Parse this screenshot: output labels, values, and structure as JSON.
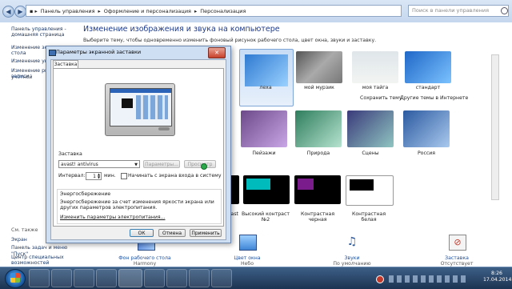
{
  "address": {
    "crumbs": [
      "Панель управления",
      "Оформление и персонализация",
      "Персонализация"
    ],
    "search_placeholder": "Поиск в панели управления"
  },
  "sidebar": {
    "top_links": [
      "Панель управления -",
      "домашняя страница"
    ],
    "links": [
      "Изменение значков",
      "стола",
      "Изменение указателей",
      "Изменение рисунка учетной",
      "записи"
    ],
    "see_also_title": "См. также",
    "see_also": [
      "Экран",
      "Панель задач и меню \"Пуск\"",
      "Центр специальных",
      "возможностей"
    ]
  },
  "main": {
    "title": "Изменение изображения и звука на компьютере",
    "subtitle": "Выберите тему, чтобы одновременно изменить фоновый рисунок рабочего стола, цвет окна, звуки и заставку.",
    "my_themes": [
      "леха",
      "мой мурзик",
      "моя тайга",
      "стандарт"
    ],
    "save_theme": "Сохранить тему",
    "more_themes": "Другие темы в Интернете",
    "aero_themes": [
      "Пейзажи",
      "Природа",
      "Сцены",
      "Россия"
    ],
    "contrast_themes": [
      "ast",
      "Высокий контраст №2",
      "Контрастная черная",
      "Контрастная белая"
    ]
  },
  "bottom": {
    "items": [
      {
        "label": "Фон рабочего стола",
        "sub": "Harmony",
        "icon": "desktop-background-icon"
      },
      {
        "label": "Цвет окна",
        "sub": "Небо",
        "icon": "window-color-icon"
      },
      {
        "label": "Звуки",
        "sub": "По умолчанию",
        "icon": "sounds-icon"
      },
      {
        "label": "Заставка",
        "sub": "Отсутствует",
        "icon": "screensaver-icon"
      }
    ]
  },
  "dialog": {
    "title": "Параметры экранной заставки",
    "tab": "Заставка",
    "screensaver_group": "Заставка",
    "screensaver_value": "avast! antivirus",
    "params_button": "Параметры...",
    "preview_button": "Просмотр",
    "interval_label": "Интервал:",
    "interval_value": "1",
    "minutes": "мин.",
    "resume_checkbox": "Начинать с экрана входа в систему",
    "power_title": "Энергосбережение",
    "power_text": "Энергосбережение за счет изменения яркости экрана или других параметров электропитания.",
    "power_link": "Изменить параметры электропитания...",
    "ok": "ОК",
    "cancel": "Отмена",
    "apply": "Применить"
  },
  "taskbar": {
    "time": "8:26",
    "date": "17.04.2014"
  },
  "colors": {
    "title_blue": "#1e3a8c",
    "link_blue": "#1e50a0",
    "taskbar": "#1c3352"
  }
}
